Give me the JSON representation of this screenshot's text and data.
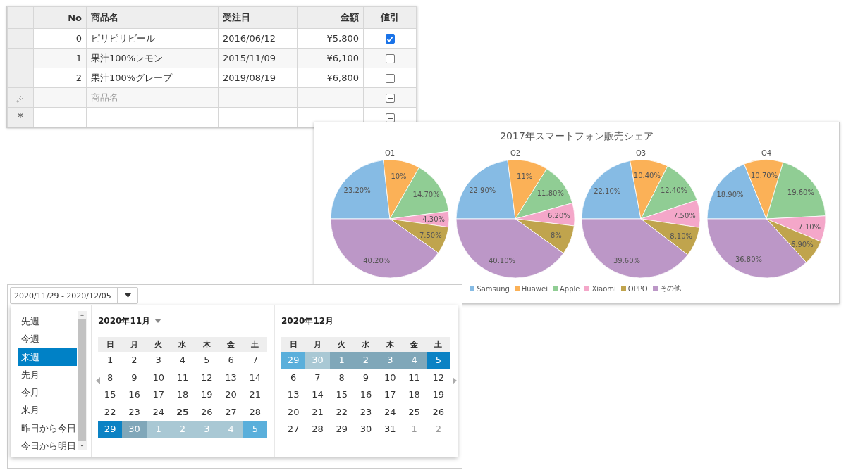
{
  "grid": {
    "columns": [
      "No",
      "商品名",
      "受注日",
      "金額",
      "値引"
    ],
    "rows": [
      {
        "kind": "data",
        "no": "0",
        "name": "ピリピリビール",
        "date": "2016/06/12",
        "amount": "¥5,800",
        "checked": true
      },
      {
        "kind": "data",
        "no": "1",
        "name": "果汁100%レモン",
        "date": "2015/11/09",
        "amount": "¥6,100",
        "checked": false
      },
      {
        "kind": "data",
        "no": "2",
        "name": "果汁100%グレープ",
        "date": "2019/08/19",
        "amount": "¥6,800",
        "checked": false
      },
      {
        "kind": "new",
        "placeholder": "商品名",
        "indeterminate": true
      },
      {
        "kind": "append",
        "marker": "*",
        "indeterminate": true
      }
    ]
  },
  "chart_panel": {
    "chart_data": {
      "type": "pie",
      "title": "2017年スマートフォン販売シェア",
      "categories": [
        "Samsung",
        "Huawei",
        "Apple",
        "Xiaomi",
        "OPPO",
        "その他"
      ],
      "data_labels": true,
      "series": [
        {
          "name": "Q1",
          "colors": [
            "#86bbe4",
            "#fbb157",
            "#90cd94",
            "#f4a7c9",
            "#c0a44d",
            "#bc97c7"
          ],
          "values": [
            23.2,
            10,
            14.7,
            4.3,
            7.5,
            40.2
          ],
          "value_labels": [
            "23.20%",
            "10%",
            "14.70%",
            "4.30%",
            "7.50%",
            "40.20%"
          ]
        },
        {
          "name": "Q2",
          "colors": [
            "#86bbe4",
            "#fbb157",
            "#90cd94",
            "#f4a7c9",
            "#c0a44d",
            "#bc97c7"
          ],
          "values": [
            22.9,
            11,
            11.8,
            6.2,
            8,
            40.1
          ],
          "value_labels": [
            "22.90%",
            "11%",
            "11.80%",
            "6.20%",
            "8%",
            "40.10%"
          ]
        },
        {
          "name": "Q3",
          "colors": [
            "#86bbe4",
            "#fbb157",
            "#90cd94",
            "#f4a7c9",
            "#c0a44d",
            "#bc97c7"
          ],
          "values": [
            22.1,
            10.4,
            12.4,
            7.5,
            8.1,
            39.6
          ],
          "value_labels": [
            "22.10%",
            "10.40%",
            "12.40%",
            "7.50%",
            "8.10%",
            "39.60%"
          ]
        },
        {
          "name": "Q4",
          "colors": [
            "#86bbe4",
            "#fbb157",
            "#90cd94",
            "#f4a7c9",
            "#c0a44d",
            "#bc97c7"
          ],
          "values": [
            18.9,
            10.7,
            19.6,
            7.1,
            6.9,
            36.8
          ],
          "value_labels": [
            "18.90%",
            "10.70%",
            "19.60%",
            "7.10%",
            "6.90%",
            "36.80%"
          ]
        }
      ]
    }
  },
  "date_picker": {
    "value": "2020/11/29 - 2020/12/05",
    "presets": [
      {
        "label": "先週",
        "selected": false
      },
      {
        "label": "今週",
        "selected": false
      },
      {
        "label": "来週",
        "selected": true
      },
      {
        "label": "先月",
        "selected": false
      },
      {
        "label": "今月",
        "selected": false
      },
      {
        "label": "来月",
        "selected": false
      },
      {
        "label": "昨日から今日",
        "selected": false
      },
      {
        "label": "今日から明日",
        "selected": false
      }
    ],
    "months": [
      {
        "title": "2020年11月",
        "has_menu": true,
        "weekdays": [
          "日",
          "月",
          "火",
          "水",
          "木",
          "金",
          "土"
        ],
        "weeks": [
          [
            {
              "day": "1",
              "kind": "plain"
            },
            {
              "day": "2",
              "kind": "plain"
            },
            {
              "day": "3",
              "kind": "plain"
            },
            {
              "day": "4",
              "kind": "plain"
            },
            {
              "day": "5",
              "kind": "plain"
            },
            {
              "day": "6",
              "kind": "plain"
            },
            {
              "day": "7",
              "kind": "plain"
            }
          ],
          [
            {
              "day": "8",
              "kind": "plain"
            },
            {
              "day": "9",
              "kind": "plain"
            },
            {
              "day": "10",
              "kind": "plain"
            },
            {
              "day": "11",
              "kind": "plain"
            },
            {
              "day": "12",
              "kind": "plain"
            },
            {
              "day": "13",
              "kind": "plain"
            },
            {
              "day": "14",
              "kind": "plain"
            }
          ],
          [
            {
              "day": "15",
              "kind": "plain"
            },
            {
              "day": "16",
              "kind": "plain"
            },
            {
              "day": "17",
              "kind": "plain"
            },
            {
              "day": "18",
              "kind": "plain"
            },
            {
              "day": "19",
              "kind": "plain"
            },
            {
              "day": "20",
              "kind": "plain"
            },
            {
              "day": "21",
              "kind": "plain"
            }
          ],
          [
            {
              "day": "22",
              "kind": "plain"
            },
            {
              "day": "23",
              "kind": "plain"
            },
            {
              "day": "24",
              "kind": "plain"
            },
            {
              "day": "25",
              "kind": "today"
            },
            {
              "day": "26",
              "kind": "plain"
            },
            {
              "day": "27",
              "kind": "plain"
            },
            {
              "day": "28",
              "kind": "plain"
            }
          ],
          [
            {
              "day": "29",
              "kind": "plain",
              "color": "#0b82c4"
            },
            {
              "day": "30",
              "kind": "plain",
              "color": "#80a7b9"
            },
            {
              "day": "1",
              "kind": "plain",
              "color": "#a9c8d4"
            },
            {
              "day": "2",
              "kind": "plain",
              "color": "#a9c8d4"
            },
            {
              "day": "3",
              "kind": "plain",
              "color": "#a9c8d4"
            },
            {
              "day": "4",
              "kind": "plain",
              "color": "#a9c8d4"
            },
            {
              "day": "5",
              "kind": "plain",
              "color": "#5aafdb"
            }
          ]
        ]
      },
      {
        "title": "2020年12月",
        "has_menu": false,
        "weekdays": [
          "日",
          "月",
          "火",
          "水",
          "木",
          "金",
          "土"
        ],
        "weeks": [
          [
            {
              "day": "29",
              "kind": "plain",
              "color": "#5aafdb"
            },
            {
              "day": "30",
              "kind": "plain",
              "color": "#a9c8d4"
            },
            {
              "day": "1",
              "kind": "plain",
              "color": "#80a7b9"
            },
            {
              "day": "2",
              "kind": "plain",
              "color": "#80a7b9"
            },
            {
              "day": "3",
              "kind": "plain",
              "color": "#80a7b9"
            },
            {
              "day": "4",
              "kind": "plain",
              "color": "#80a7b9"
            },
            {
              "day": "5",
              "kind": "plain",
              "color": "#0b82c4"
            }
          ],
          [
            {
              "day": "6",
              "kind": "plain"
            },
            {
              "day": "7",
              "kind": "plain"
            },
            {
              "day": "8",
              "kind": "plain"
            },
            {
              "day": "9",
              "kind": "plain"
            },
            {
              "day": "10",
              "kind": "plain"
            },
            {
              "day": "11",
              "kind": "plain"
            },
            {
              "day": "12",
              "kind": "plain"
            }
          ],
          [
            {
              "day": "13",
              "kind": "plain"
            },
            {
              "day": "14",
              "kind": "plain"
            },
            {
              "day": "15",
              "kind": "plain"
            },
            {
              "day": "16",
              "kind": "plain"
            },
            {
              "day": "17",
              "kind": "plain"
            },
            {
              "day": "18",
              "kind": "plain"
            },
            {
              "day": "19",
              "kind": "plain"
            }
          ],
          [
            {
              "day": "20",
              "kind": "plain"
            },
            {
              "day": "21",
              "kind": "plain"
            },
            {
              "day": "22",
              "kind": "plain"
            },
            {
              "day": "23",
              "kind": "plain"
            },
            {
              "day": "24",
              "kind": "plain"
            },
            {
              "day": "25",
              "kind": "plain"
            },
            {
              "day": "26",
              "kind": "plain"
            }
          ],
          [
            {
              "day": "27",
              "kind": "plain"
            },
            {
              "day": "28",
              "kind": "plain"
            },
            {
              "day": "29",
              "kind": "plain"
            },
            {
              "day": "30",
              "kind": "plain"
            },
            {
              "day": "31",
              "kind": "plain"
            },
            {
              "day": "1",
              "kind": "adjacent"
            },
            {
              "day": "2",
              "kind": "adjacent"
            }
          ]
        ]
      }
    ]
  }
}
